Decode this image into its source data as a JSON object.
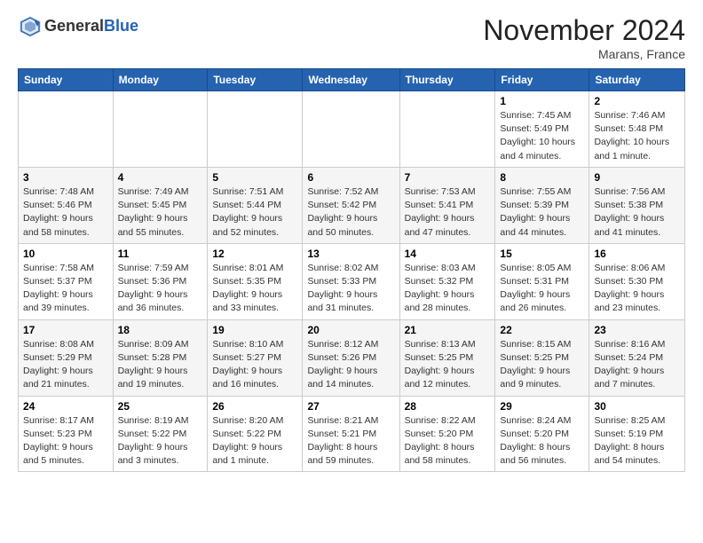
{
  "header": {
    "logo_line1": "General",
    "logo_line2": "Blue",
    "month": "November 2024",
    "location": "Marans, France"
  },
  "weekdays": [
    "Sunday",
    "Monday",
    "Tuesday",
    "Wednesday",
    "Thursday",
    "Friday",
    "Saturday"
  ],
  "weeks": [
    [
      {
        "day": "",
        "info": ""
      },
      {
        "day": "",
        "info": ""
      },
      {
        "day": "",
        "info": ""
      },
      {
        "day": "",
        "info": ""
      },
      {
        "day": "",
        "info": ""
      },
      {
        "day": "1",
        "info": "Sunrise: 7:45 AM\nSunset: 5:49 PM\nDaylight: 10 hours\nand 4 minutes."
      },
      {
        "day": "2",
        "info": "Sunrise: 7:46 AM\nSunset: 5:48 PM\nDaylight: 10 hours\nand 1 minute."
      }
    ],
    [
      {
        "day": "3",
        "info": "Sunrise: 7:48 AM\nSunset: 5:46 PM\nDaylight: 9 hours\nand 58 minutes."
      },
      {
        "day": "4",
        "info": "Sunrise: 7:49 AM\nSunset: 5:45 PM\nDaylight: 9 hours\nand 55 minutes."
      },
      {
        "day": "5",
        "info": "Sunrise: 7:51 AM\nSunset: 5:44 PM\nDaylight: 9 hours\nand 52 minutes."
      },
      {
        "day": "6",
        "info": "Sunrise: 7:52 AM\nSunset: 5:42 PM\nDaylight: 9 hours\nand 50 minutes."
      },
      {
        "day": "7",
        "info": "Sunrise: 7:53 AM\nSunset: 5:41 PM\nDaylight: 9 hours\nand 47 minutes."
      },
      {
        "day": "8",
        "info": "Sunrise: 7:55 AM\nSunset: 5:39 PM\nDaylight: 9 hours\nand 44 minutes."
      },
      {
        "day": "9",
        "info": "Sunrise: 7:56 AM\nSunset: 5:38 PM\nDaylight: 9 hours\nand 41 minutes."
      }
    ],
    [
      {
        "day": "10",
        "info": "Sunrise: 7:58 AM\nSunset: 5:37 PM\nDaylight: 9 hours\nand 39 minutes."
      },
      {
        "day": "11",
        "info": "Sunrise: 7:59 AM\nSunset: 5:36 PM\nDaylight: 9 hours\nand 36 minutes."
      },
      {
        "day": "12",
        "info": "Sunrise: 8:01 AM\nSunset: 5:35 PM\nDaylight: 9 hours\nand 33 minutes."
      },
      {
        "day": "13",
        "info": "Sunrise: 8:02 AM\nSunset: 5:33 PM\nDaylight: 9 hours\nand 31 minutes."
      },
      {
        "day": "14",
        "info": "Sunrise: 8:03 AM\nSunset: 5:32 PM\nDaylight: 9 hours\nand 28 minutes."
      },
      {
        "day": "15",
        "info": "Sunrise: 8:05 AM\nSunset: 5:31 PM\nDaylight: 9 hours\nand 26 minutes."
      },
      {
        "day": "16",
        "info": "Sunrise: 8:06 AM\nSunset: 5:30 PM\nDaylight: 9 hours\nand 23 minutes."
      }
    ],
    [
      {
        "day": "17",
        "info": "Sunrise: 8:08 AM\nSunset: 5:29 PM\nDaylight: 9 hours\nand 21 minutes."
      },
      {
        "day": "18",
        "info": "Sunrise: 8:09 AM\nSunset: 5:28 PM\nDaylight: 9 hours\nand 19 minutes."
      },
      {
        "day": "19",
        "info": "Sunrise: 8:10 AM\nSunset: 5:27 PM\nDaylight: 9 hours\nand 16 minutes."
      },
      {
        "day": "20",
        "info": "Sunrise: 8:12 AM\nSunset: 5:26 PM\nDaylight: 9 hours\nand 14 minutes."
      },
      {
        "day": "21",
        "info": "Sunrise: 8:13 AM\nSunset: 5:25 PM\nDaylight: 9 hours\nand 12 minutes."
      },
      {
        "day": "22",
        "info": "Sunrise: 8:15 AM\nSunset: 5:25 PM\nDaylight: 9 hours\nand 9 minutes."
      },
      {
        "day": "23",
        "info": "Sunrise: 8:16 AM\nSunset: 5:24 PM\nDaylight: 9 hours\nand 7 minutes."
      }
    ],
    [
      {
        "day": "24",
        "info": "Sunrise: 8:17 AM\nSunset: 5:23 PM\nDaylight: 9 hours\nand 5 minutes."
      },
      {
        "day": "25",
        "info": "Sunrise: 8:19 AM\nSunset: 5:22 PM\nDaylight: 9 hours\nand 3 minutes."
      },
      {
        "day": "26",
        "info": "Sunrise: 8:20 AM\nSunset: 5:22 PM\nDaylight: 9 hours\nand 1 minute."
      },
      {
        "day": "27",
        "info": "Sunrise: 8:21 AM\nSunset: 5:21 PM\nDaylight: 8 hours\nand 59 minutes."
      },
      {
        "day": "28",
        "info": "Sunrise: 8:22 AM\nSunset: 5:20 PM\nDaylight: 8 hours\nand 58 minutes."
      },
      {
        "day": "29",
        "info": "Sunrise: 8:24 AM\nSunset: 5:20 PM\nDaylight: 8 hours\nand 56 minutes."
      },
      {
        "day": "30",
        "info": "Sunrise: 8:25 AM\nSunset: 5:19 PM\nDaylight: 8 hours\nand 54 minutes."
      }
    ]
  ]
}
